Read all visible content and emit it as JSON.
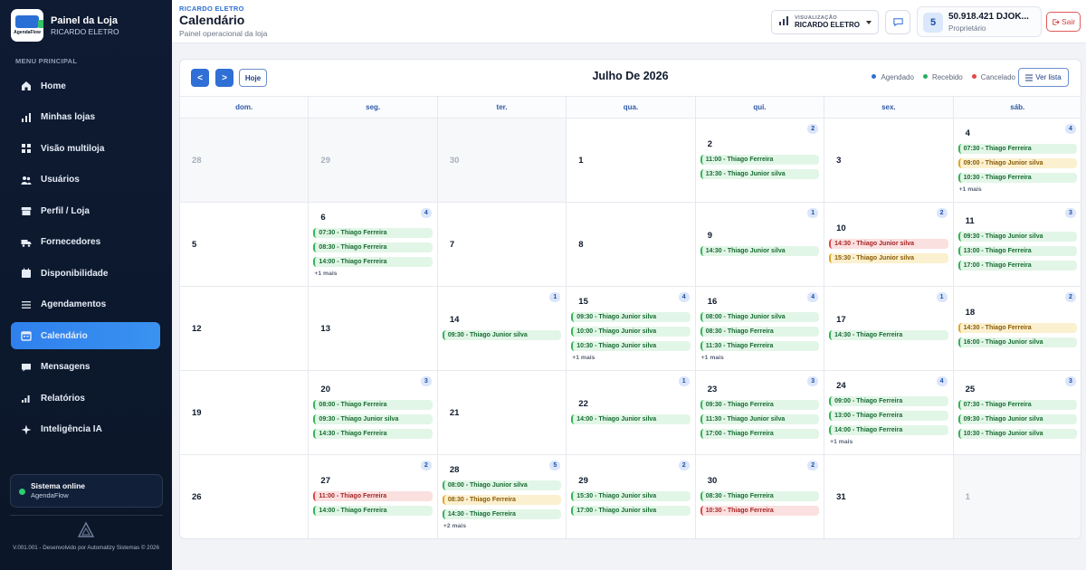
{
  "brand": {
    "title": "Painel da Loja",
    "subtitle": "RICARDO ELETRO",
    "logo_text": "AgendaFlow"
  },
  "menu_heading": "MENU PRINCIPAL",
  "menu": [
    {
      "label": "Home",
      "icon": "home-icon"
    },
    {
      "label": "Minhas lojas",
      "icon": "chart-icon"
    },
    {
      "label": "Visão multiloja",
      "icon": "grid-icon"
    },
    {
      "label": "Usuários",
      "icon": "users-icon"
    },
    {
      "label": "Perfil / Loja",
      "icon": "store-icon"
    },
    {
      "label": "Fornecedores",
      "icon": "truck-icon"
    },
    {
      "label": "Disponibilidade",
      "icon": "calendar-check-icon"
    },
    {
      "label": "Agendamentos",
      "icon": "list-icon"
    },
    {
      "label": "Calendário",
      "icon": "calendar-icon",
      "active": true
    },
    {
      "label": "Mensagens",
      "icon": "message-icon"
    },
    {
      "label": "Relatórios",
      "icon": "bar-chart-icon"
    },
    {
      "label": "Inteligência IA",
      "icon": "sparkle-icon"
    }
  ],
  "system_status": {
    "title": "Sistema online",
    "subtitle": "AgendaFlow",
    "color": "#2ecc71"
  },
  "footer": "V.001.001 - Desenvolvido por Automatizy Sistemas © 2026",
  "header": {
    "kicker": "RICARDO ELETRO",
    "title": "Calendário",
    "subtitle": "Painel operacional da loja",
    "view_label": "VISUALIZAÇÃO",
    "view_value": "RICARDO ELETRO",
    "user_badge": "5",
    "user_name": "50.918.421 DJOK...",
    "user_role": "Proprietário",
    "logout": "Sair"
  },
  "calendar": {
    "prev": "<",
    "next": ">",
    "today": "Hoje",
    "month": "Julho De 2026",
    "legend": [
      {
        "label": "Agendado",
        "color": "#2f6fd6"
      },
      {
        "label": "Recebido",
        "color": "#27ae60"
      },
      {
        "label": "Cancelado",
        "color": "#e04747"
      }
    ],
    "list_button": "Ver lista",
    "weekdays": [
      "dom.",
      "seg.",
      "ter.",
      "qua.",
      "qui.",
      "sex.",
      "sáb."
    ],
    "weeks": [
      [
        {
          "day": "28",
          "muted": true
        },
        {
          "day": "29",
          "muted": true
        },
        {
          "day": "30",
          "muted": true
        },
        {
          "day": "1"
        },
        {
          "day": "2",
          "count": "2",
          "events": [
            {
              "text": "11:00 - Thiago Ferreira",
              "c": "green"
            },
            {
              "text": "13:30 - Thiago Junior silva",
              "c": "green"
            }
          ]
        },
        {
          "day": "3"
        },
        {
          "day": "4",
          "count": "4",
          "events": [
            {
              "text": "07:30 - Thiago Ferreira",
              "c": "green"
            },
            {
              "text": "09:00 - Thiago Junior silva",
              "c": "yellow"
            },
            {
              "text": "10:30 - Thiago Ferreira",
              "c": "green"
            }
          ],
          "more": "+1 mais"
        }
      ],
      [
        {
          "day": "5"
        },
        {
          "day": "6",
          "count": "4",
          "events": [
            {
              "text": "07:30 - Thiago Ferreira",
              "c": "green"
            },
            {
              "text": "08:30 - Thiago Ferreira",
              "c": "green"
            },
            {
              "text": "14:00 - Thiago Ferreira",
              "c": "green"
            }
          ],
          "more": "+1 mais"
        },
        {
          "day": "7"
        },
        {
          "day": "8"
        },
        {
          "day": "9",
          "count": "1",
          "events": [
            {
              "text": "14:30 - Thiago Junior silva",
              "c": "green"
            }
          ]
        },
        {
          "day": "10",
          "count": "2",
          "events": [
            {
              "text": "14:30 - Thiago Junior silva",
              "c": "red"
            },
            {
              "text": "15:30 - Thiago Junior silva",
              "c": "yellow"
            }
          ]
        },
        {
          "day": "11",
          "count": "3",
          "events": [
            {
              "text": "09:30 - Thiago Junior silva",
              "c": "green"
            },
            {
              "text": "13:00 - Thiago Ferreira",
              "c": "green"
            },
            {
              "text": "17:00 - Thiago Ferreira",
              "c": "green"
            }
          ]
        }
      ],
      [
        {
          "day": "12"
        },
        {
          "day": "13"
        },
        {
          "day": "14",
          "count": "1",
          "events": [
            {
              "text": "09:30 - Thiago Junior silva",
              "c": "green"
            }
          ]
        },
        {
          "day": "15",
          "count": "4",
          "events": [
            {
              "text": "09:30 - Thiago Junior silva",
              "c": "green"
            },
            {
              "text": "10:00 - Thiago Junior silva",
              "c": "green"
            },
            {
              "text": "10:30 - Thiago Junior silva",
              "c": "green"
            }
          ],
          "more": "+1 mais"
        },
        {
          "day": "16",
          "count": "4",
          "events": [
            {
              "text": "08:00 - Thiago Junior silva",
              "c": "green"
            },
            {
              "text": "08:30 - Thiago Ferreira",
              "c": "green"
            },
            {
              "text": "11:30 - Thiago Ferreira",
              "c": "green"
            }
          ],
          "more": "+1 mais"
        },
        {
          "day": "17",
          "count": "1",
          "events": [
            {
              "text": "14:30 - Thiago Ferreira",
              "c": "green"
            }
          ]
        },
        {
          "day": "18",
          "count": "2",
          "events": [
            {
              "text": "14:30 - Thiago Ferreira",
              "c": "yellow"
            },
            {
              "text": "16:00 - Thiago Junior silva",
              "c": "green"
            }
          ]
        }
      ],
      [
        {
          "day": "19"
        },
        {
          "day": "20",
          "count": "3",
          "events": [
            {
              "text": "08:00 - Thiago Ferreira",
              "c": "green"
            },
            {
              "text": "09:30 - Thiago Junior silva",
              "c": "green"
            },
            {
              "text": "14:30 - Thiago Ferreira",
              "c": "green"
            }
          ]
        },
        {
          "day": "21"
        },
        {
          "day": "22",
          "count": "1",
          "events": [
            {
              "text": "14:00 - Thiago Junior silva",
              "c": "green"
            }
          ]
        },
        {
          "day": "23",
          "count": "3",
          "events": [
            {
              "text": "09:30 - Thiago Ferreira",
              "c": "green"
            },
            {
              "text": "11:30 - Thiago Junior silva",
              "c": "green"
            },
            {
              "text": "17:00 - Thiago Ferreira",
              "c": "green"
            }
          ]
        },
        {
          "day": "24",
          "count": "4",
          "events": [
            {
              "text": "09:00 - Thiago Ferreira",
              "c": "green"
            },
            {
              "text": "13:00 - Thiago Ferreira",
              "c": "green"
            },
            {
              "text": "14:00 - Thiago Ferreira",
              "c": "green"
            }
          ],
          "more": "+1 mais"
        },
        {
          "day": "25",
          "count": "3",
          "events": [
            {
              "text": "07:30 - Thiago Ferreira",
              "c": "green"
            },
            {
              "text": "09:30 - Thiago Junior silva",
              "c": "green"
            },
            {
              "text": "10:30 - Thiago Junior silva",
              "c": "green"
            }
          ]
        }
      ],
      [
        {
          "day": "26"
        },
        {
          "day": "27",
          "count": "2",
          "events": [
            {
              "text": "11:00 - Thiago Ferreira",
              "c": "red"
            },
            {
              "text": "14:00 - Thiago Ferreira",
              "c": "green"
            }
          ]
        },
        {
          "day": "28",
          "count": "5",
          "events": [
            {
              "text": "08:00 - Thiago Junior silva",
              "c": "green"
            },
            {
              "text": "08:30 - Thiago Ferreira",
              "c": "yellow"
            },
            {
              "text": "14:30 - Thiago Ferreira",
              "c": "green"
            }
          ],
          "more": "+2 mais"
        },
        {
          "day": "29",
          "count": "2",
          "events": [
            {
              "text": "15:30 - Thiago Junior silva",
              "c": "green"
            },
            {
              "text": "17:00 - Thiago Junior silva",
              "c": "green"
            }
          ]
        },
        {
          "day": "30",
          "count": "2",
          "events": [
            {
              "text": "08:30 - Thiago Ferreira",
              "c": "green"
            },
            {
              "text": "10:30 - Thiago Ferreira",
              "c": "red"
            }
          ]
        },
        {
          "day": "31"
        },
        {
          "day": "1",
          "muted": true
        }
      ]
    ]
  }
}
